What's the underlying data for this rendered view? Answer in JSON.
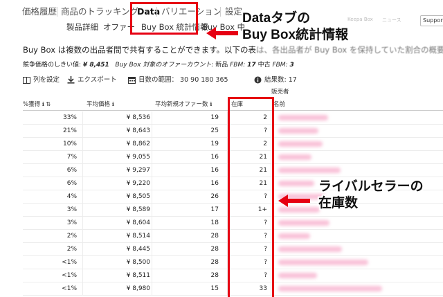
{
  "top_tabs": [
    {
      "label": "価格履歴"
    },
    {
      "label": "商品のトラッキング"
    },
    {
      "label": "Data"
    },
    {
      "label": "バリエーション"
    },
    {
      "label": "設定"
    }
  ],
  "top_right": {
    "keepa_box": "Keepa Box",
    "news": "ニュース",
    "support": "Support"
  },
  "sub_tabs": [
    {
      "label": "製品詳細"
    },
    {
      "label": "オファー"
    },
    {
      "label": "Buy Box 統計情報"
    },
    {
      "label": "Buy Box 中"
    }
  ],
  "description": {
    "text": "Buy Box は複数の出品者間で共有することができます。以下の表",
    "faded": "は、各出品者が Buy Box を保持していた割合の概要を"
  },
  "stats": {
    "threshold_label": "競争価格のしきい値:",
    "threshold_value": "¥ 8,451",
    "offer_count_label": "Buy Box 対象のオファーカウント:",
    "new_label": "新品",
    "fbm_label": "FBM:",
    "new_fbm": "17",
    "used_label": "中古",
    "used_fbm": "3"
  },
  "toolbar": {
    "columns": "列を設定",
    "export": "エクスポート",
    "range_label": "日数の範囲：",
    "range_values": "30 90 180 365",
    "results_label": "結果数:",
    "results_count": "17"
  },
  "table": {
    "headers": {
      "share": "%獲得",
      "avg_price": "平均価格",
      "avg_new_offers": "平均新規オファー数",
      "stock": "在庫",
      "name": "名前",
      "seller": "販売者"
    },
    "rows": [
      {
        "share": "33%",
        "price": "¥ 8,536",
        "offers": "19",
        "stock": "2"
      },
      {
        "share": "21%",
        "price": "¥ 8,643",
        "offers": "25",
        "stock": "?"
      },
      {
        "share": "10%",
        "price": "¥ 8,862",
        "offers": "19",
        "stock": "2"
      },
      {
        "share": "7%",
        "price": "¥ 9,055",
        "offers": "16",
        "stock": "21"
      },
      {
        "share": "6%",
        "price": "¥ 9,297",
        "offers": "16",
        "stock": "21"
      },
      {
        "share": "6%",
        "price": "¥ 9,220",
        "offers": "16",
        "stock": "21"
      },
      {
        "share": "4%",
        "price": "¥ 8,505",
        "offers": "26",
        "stock": "?"
      },
      {
        "share": "3%",
        "price": "¥ 8,589",
        "offers": "17",
        "stock": "1+"
      },
      {
        "share": "3%",
        "price": "¥ 8,604",
        "offers": "18",
        "stock": "?"
      },
      {
        "share": "2%",
        "price": "¥ 8,514",
        "offers": "28",
        "stock": "?"
      },
      {
        "share": "2%",
        "price": "¥ 8,445",
        "offers": "28",
        "stock": "?"
      },
      {
        "share": "<1%",
        "price": "¥ 8,500",
        "offers": "28",
        "stock": "?"
      },
      {
        "share": "<1%",
        "price": "¥ 8,511",
        "offers": "28",
        "stock": "?"
      },
      {
        "share": "<1%",
        "price": "¥ 8,980",
        "offers": "15",
        "stock": "33"
      }
    ]
  },
  "annotations": {
    "callout_1_line1": "Dataタブの",
    "callout_1_line2": "Buy Box統計情報",
    "callout_2_line1": "ライバルセラーの",
    "callout_2_line2": "在庫数",
    "arrow_color": "#e60012"
  },
  "colors": {
    "accent_red": "#e60012",
    "redacted_seller": "#f48fb8"
  }
}
